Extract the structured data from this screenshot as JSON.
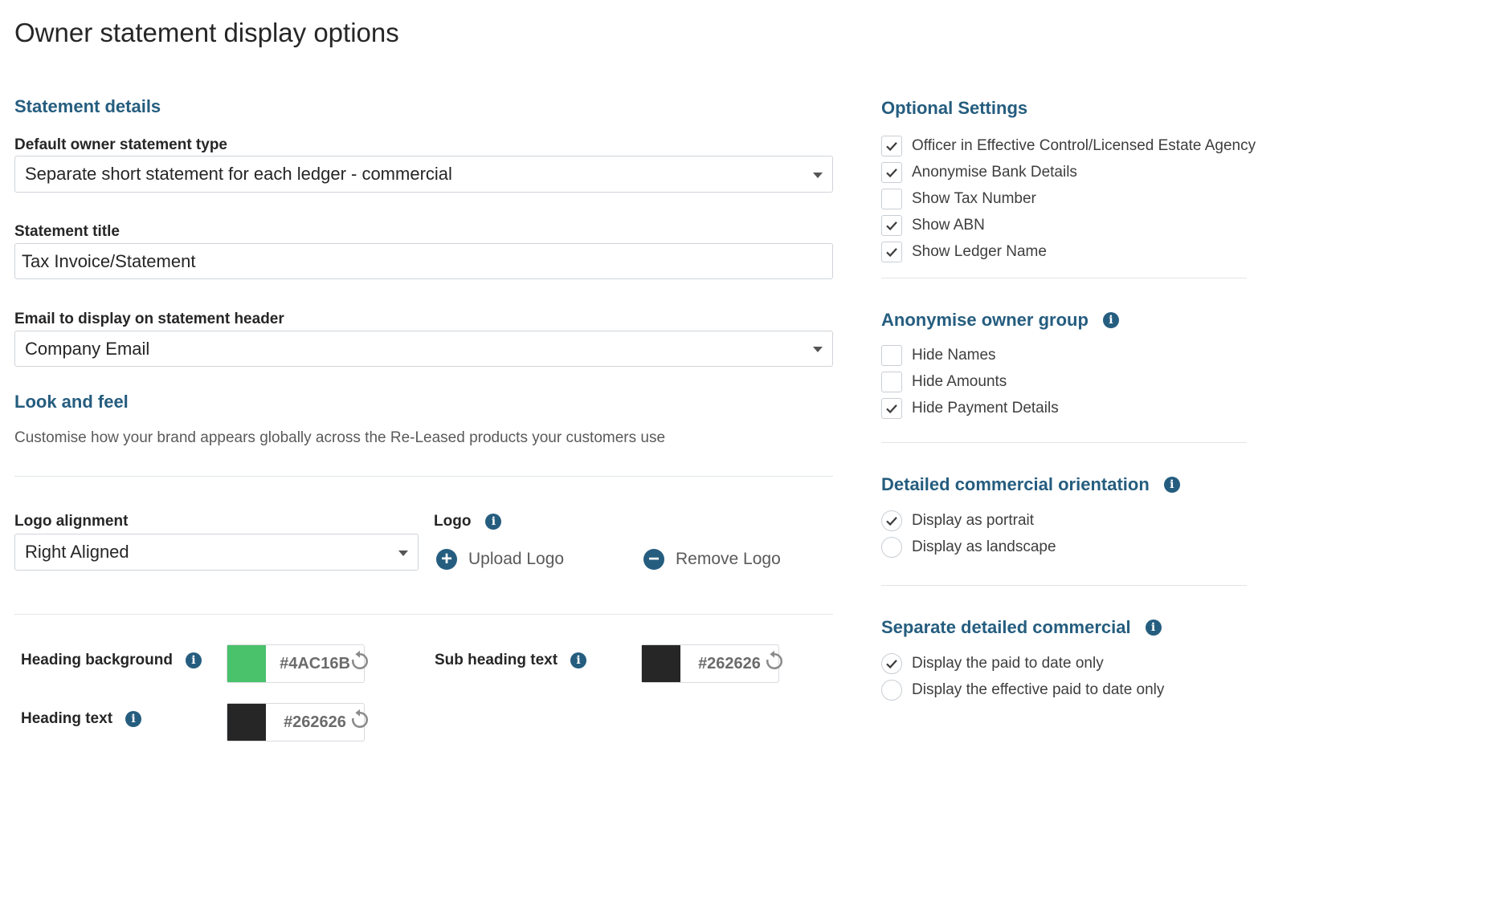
{
  "page_title": "Owner statement display options",
  "statement_details": {
    "title": "Statement details",
    "default_type": {
      "label": "Default owner statement type",
      "value": "Separate short statement for each ledger - commercial"
    },
    "statement_title": {
      "label": "Statement title",
      "value": "Tax Invoice/Statement"
    },
    "email_header": {
      "label": "Email to display on statement header",
      "value": "Company Email"
    }
  },
  "look_and_feel": {
    "title": "Look and feel",
    "description": "Customise how your brand appears globally across the Re-Leased products your customers use",
    "logo_alignment": {
      "label": "Logo alignment",
      "value": "Right Aligned"
    },
    "logo": {
      "label": "Logo",
      "upload_label": "Upload Logo",
      "remove_label": "Remove Logo"
    },
    "colors": {
      "heading_background": {
        "label": "Heading background",
        "hex": "#4AC16B",
        "swatch": "#4ac16b"
      },
      "sub_heading_text": {
        "label": "Sub heading text",
        "hex": "#262626",
        "swatch": "#262626"
      },
      "heading_text": {
        "label": "Heading text",
        "hex": "#262626",
        "swatch": "#262626"
      }
    }
  },
  "optional_settings": {
    "title": "Optional Settings",
    "items": [
      {
        "label": "Officer in Effective Control/Licensed Estate Agency",
        "checked": true
      },
      {
        "label": "Anonymise Bank Details",
        "checked": true
      },
      {
        "label": "Show Tax Number",
        "checked": false
      },
      {
        "label": "Show ABN",
        "checked": true
      },
      {
        "label": "Show Ledger Name",
        "checked": true
      }
    ]
  },
  "anonymise_owner_group": {
    "title": "Anonymise owner group",
    "items": [
      {
        "label": "Hide Names",
        "checked": false
      },
      {
        "label": "Hide Amounts",
        "checked": false
      },
      {
        "label": "Hide Payment Details",
        "checked": true
      }
    ]
  },
  "detailed_commercial_orientation": {
    "title": "Detailed commercial orientation",
    "options": [
      {
        "label": "Display as portrait",
        "selected": true
      },
      {
        "label": "Display as landscape",
        "selected": false
      }
    ]
  },
  "separate_detailed_commercial": {
    "title": "Separate detailed commercial",
    "options": [
      {
        "label": "Display the paid to date only",
        "selected": true
      },
      {
        "label": "Display the effective paid to date only",
        "selected": false
      }
    ]
  },
  "icons": {
    "info": "info-icon",
    "checkmark": "checkmark-icon",
    "reset": "reset-icon",
    "plus": "plus-circle-icon",
    "minus": "minus-circle-icon",
    "caret": "chevron-down-icon"
  },
  "colors": {
    "accent": "#255d7f",
    "border": "#cfd4d9",
    "text": "#262626"
  }
}
